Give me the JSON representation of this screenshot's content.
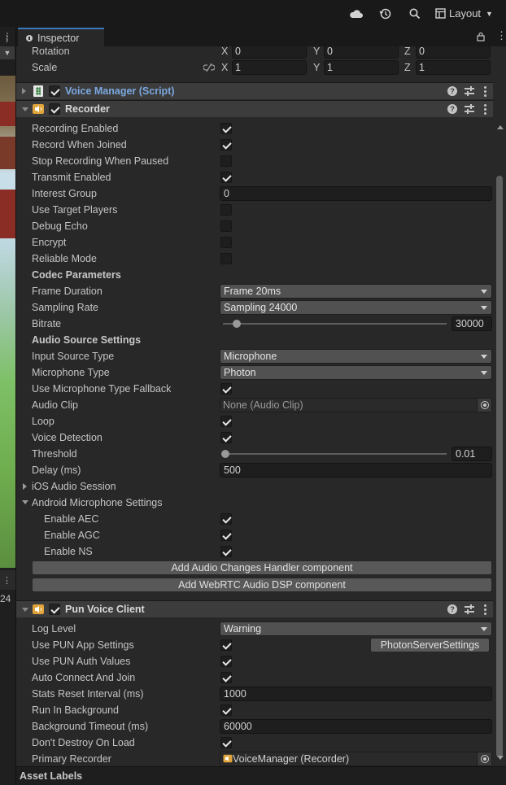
{
  "topbar": {
    "layout_label": "Layout"
  },
  "left_strip": {
    "number": "24"
  },
  "tab": {
    "title": "Inspector"
  },
  "transform": {
    "rotation": {
      "label": "Rotation",
      "x": "0",
      "y": "0",
      "z": "0"
    },
    "scale": {
      "label": "Scale",
      "x": "1",
      "y": "1",
      "z": "1"
    },
    "axis": {
      "x": "X",
      "y": "Y",
      "z": "Z"
    }
  },
  "voice_manager": {
    "title": "Voice Manager (Script)"
  },
  "recorder": {
    "title": "Recorder",
    "recording_enabled": {
      "label": "Recording Enabled",
      "checked": true
    },
    "record_when_joined": {
      "label": "Record When Joined",
      "checked": true
    },
    "stop_recording_when_paused": {
      "label": "Stop Recording When Paused",
      "checked": false
    },
    "transmit_enabled": {
      "label": "Transmit Enabled",
      "checked": true
    },
    "interest_group": {
      "label": "Interest Group",
      "value": "0"
    },
    "use_target_players": {
      "label": "Use Target Players",
      "checked": false
    },
    "debug_echo": {
      "label": "Debug Echo",
      "checked": false
    },
    "encrypt": {
      "label": "Encrypt",
      "checked": false
    },
    "reliable_mode": {
      "label": "Reliable Mode",
      "checked": false
    },
    "codec_header": "Codec Parameters",
    "frame_duration": {
      "label": "Frame Duration",
      "value": "Frame 20ms"
    },
    "sampling_rate": {
      "label": "Sampling Rate",
      "value": "Sampling 24000"
    },
    "bitrate": {
      "label": "Bitrate",
      "value": "30000",
      "fraction": 0.06
    },
    "audio_source_header": "Audio Source Settings",
    "input_source_type": {
      "label": "Input Source Type",
      "value": "Microphone"
    },
    "microphone_type": {
      "label": "Microphone Type",
      "value": "Photon"
    },
    "use_mic_fallback": {
      "label": "Use Microphone Type Fallback",
      "checked": true
    },
    "audio_clip": {
      "label": "Audio Clip",
      "value": "None (Audio Clip)"
    },
    "loop": {
      "label": "Loop",
      "checked": true
    },
    "voice_detection": {
      "label": "Voice Detection",
      "checked": true
    },
    "threshold": {
      "label": "Threshold",
      "value": "0.01",
      "fraction": 0.01
    },
    "delay": {
      "label": "Delay (ms)",
      "value": "500"
    },
    "ios_audio_session": {
      "label": "iOS Audio Session"
    },
    "android_mic_settings": {
      "label": "Android Microphone Settings"
    },
    "enable_aec": {
      "label": "Enable AEC",
      "checked": true
    },
    "enable_agc": {
      "label": "Enable AGC",
      "checked": true
    },
    "enable_ns": {
      "label": "Enable NS",
      "checked": true
    },
    "add_audio_changes_btn": "Add Audio Changes Handler component",
    "add_webrtc_btn": "Add WebRTC Audio DSP component"
  },
  "pun_voice_client": {
    "title": "Pun Voice Client",
    "log_level": {
      "label": "Log Level",
      "value": "Warning"
    },
    "use_pun_app_settings": {
      "label": "Use PUN App Settings",
      "checked": true
    },
    "photon_server_settings_btn": "PhotonServerSettings",
    "use_pun_auth_values": {
      "label": "Use PUN Auth Values",
      "checked": true
    },
    "auto_connect_and_join": {
      "label": "Auto Connect And Join",
      "checked": true
    },
    "stats_reset_interval": {
      "label": "Stats Reset Interval (ms)",
      "value": "1000"
    },
    "run_in_background": {
      "label": "Run In Background",
      "checked": true
    },
    "background_timeout": {
      "label": "Background Timeout (ms)",
      "value": "60000"
    },
    "dont_destroy_on_load": {
      "label": "Don't Destroy On Load",
      "checked": true
    },
    "primary_recorder": {
      "label": "Primary Recorder",
      "value": "VoiceManager (Recorder)"
    }
  },
  "footer": {
    "asset_labels": "Asset Labels"
  },
  "colors": {
    "accent_tab": "#3a79bb",
    "script_title": "#7ba8e0",
    "component_icon": "#e0a43a"
  }
}
